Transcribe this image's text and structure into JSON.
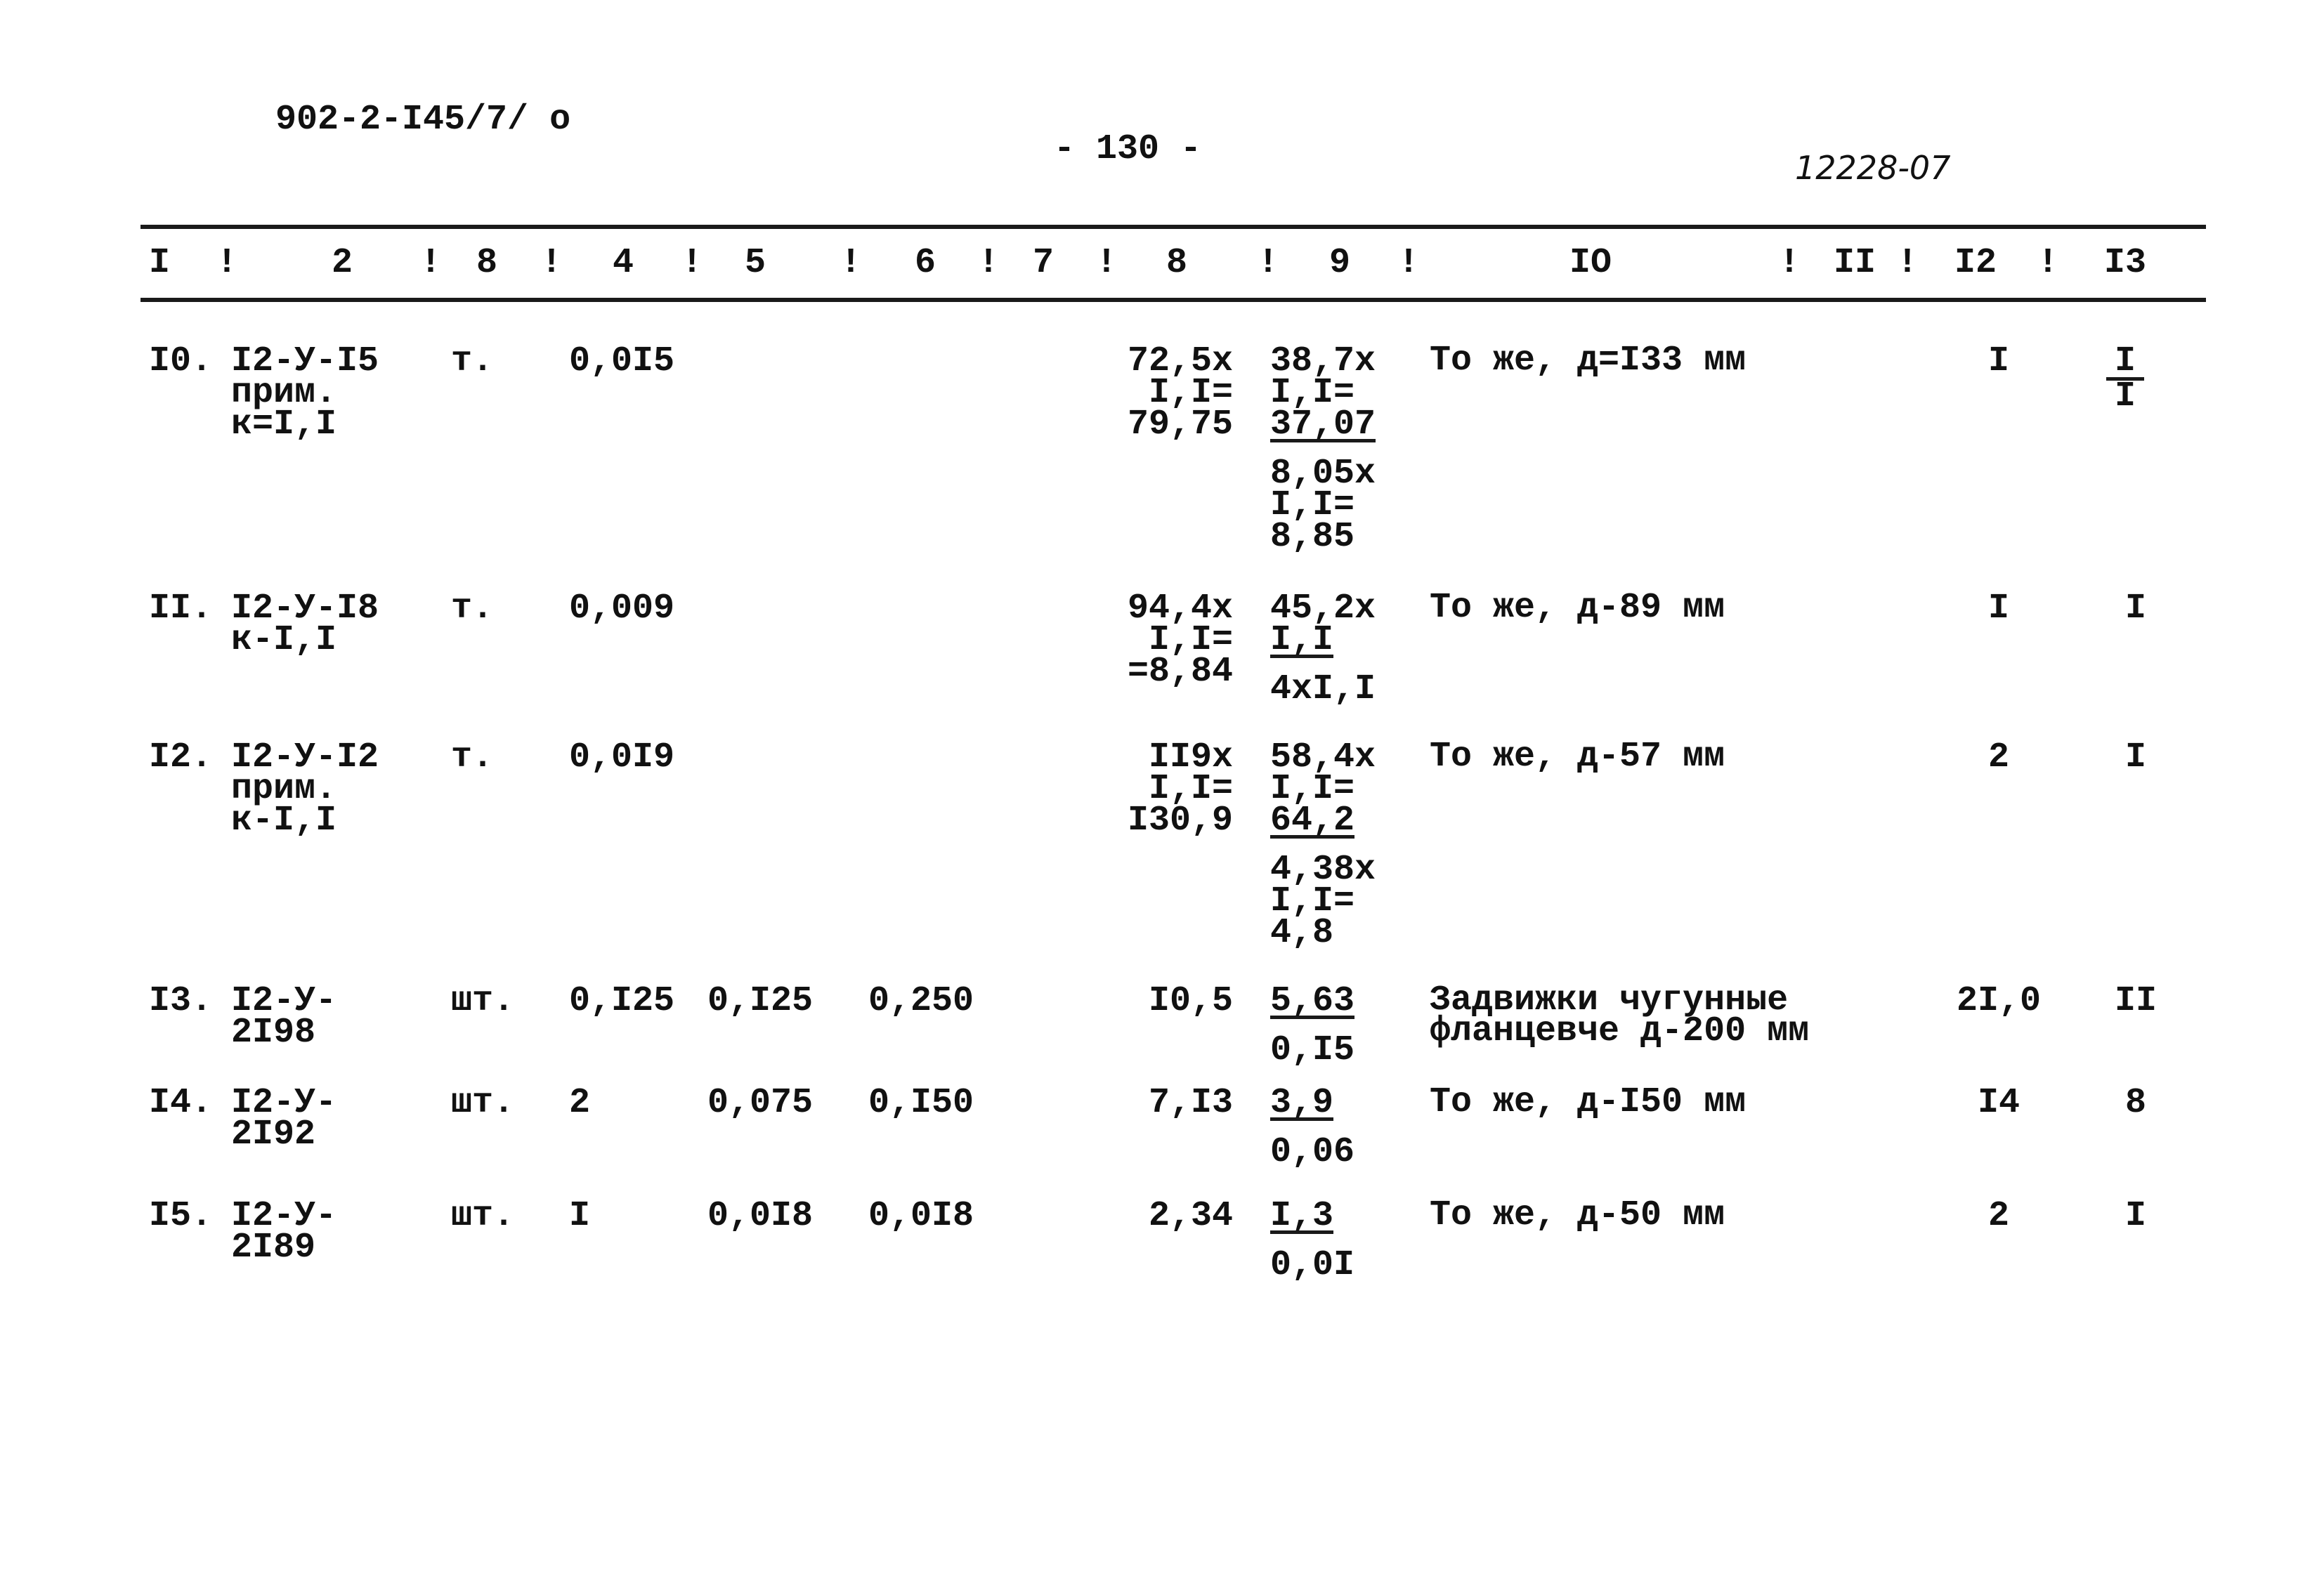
{
  "header": {
    "doc_code": "902-2-I45/7/ о",
    "page_number": "- 130 -",
    "doc_number": "12228-07"
  },
  "table": {
    "columns": [
      "I",
      "!",
      "2",
      "!",
      "8",
      "!",
      "4",
      "!",
      "5",
      "!",
      "6",
      "!",
      "7",
      "!",
      "8",
      "!",
      "9",
      "!",
      "IO",
      "!",
      "II",
      "!",
      "I2",
      "!",
      "I3"
    ],
    "rows": [
      {
        "num": "I0.",
        "code": [
          "I2-У-I5",
          "прим.",
          "к=I,I"
        ],
        "unit": "т.",
        "c4": "0,0I5",
        "c5": "",
        "c6": "",
        "c8": [
          "72,5х",
          "I,I=",
          "79,75"
        ],
        "c9a": [
          "38,7х",
          "I,I="
        ],
        "c9u": "37,07",
        "c9b": [
          "8,05х",
          "I,I=",
          "8,85"
        ],
        "c10": [
          "То же, д=I33 мм"
        ],
        "c12": "I",
        "c13_num": "I",
        "c13_den": "I"
      },
      {
        "num": "II.",
        "code": [
          "I2-У-I8",
          "к-I,I"
        ],
        "unit": "т.",
        "c4": "0,009",
        "c5": "",
        "c6": "",
        "c8": [
          "94,4х",
          "I,I=",
          "=8,84"
        ],
        "c9a": [
          "45,2х"
        ],
        "c9u": "I,I",
        "c9b": [
          "4хI,I"
        ],
        "c10": [
          "То же, д-89 мм"
        ],
        "c12": "I",
        "c13": "I"
      },
      {
        "num": "I2.",
        "code": [
          "I2-У-I2",
          "прим.",
          "к-I,I"
        ],
        "unit": "т.",
        "c4": "0,0I9",
        "c5": "",
        "c6": "",
        "c8": [
          "II9х",
          "I,I=",
          "I30,9"
        ],
        "c9a": [
          "58,4х",
          "I,I="
        ],
        "c9u": "64,2",
        "c9b": [
          "4,38х",
          "I,I=",
          "4,8"
        ],
        "c10": [
          "То же, д-57 мм"
        ],
        "c12": "2",
        "c13": "I"
      },
      {
        "num": "I3.",
        "code": [
          "I2-У-",
          "2I98"
        ],
        "unit": "шт.",
        "c4": "0,I25",
        "c5": "0,I25",
        "c6": "0,250",
        "c8": [
          "I0,5"
        ],
        "c9a": [],
        "c9u": "5,63",
        "c9b": [
          "0,I5"
        ],
        "c10": [
          "Задвижки чугунные",
          "фланцевче д-200 мм"
        ],
        "c12": "2I,0",
        "c13": "II"
      },
      {
        "num": "I4.",
        "code": [
          "I2-У-",
          "2I92"
        ],
        "unit": "шт.",
        "c4": "2",
        "c5": "0,075",
        "c6": "0,I50",
        "c8": [
          "7,I3"
        ],
        "c9a": [],
        "c9u": "3,9",
        "c9b": [
          "0,06"
        ],
        "c10": [
          "То же, д-I50 мм"
        ],
        "c12": "I4",
        "c13": "8"
      },
      {
        "num": "I5.",
        "code": [
          "I2-У-",
          "2I89"
        ],
        "unit": "шт.",
        "c4": "I",
        "c5": "0,0I8",
        "c6": "0,0I8",
        "c8": [
          "2,34"
        ],
        "c9a": [],
        "c9u": "I,3",
        "c9b": [
          "0,0I"
        ],
        "c10": [
          "То же, д-50 мм"
        ],
        "c12": "2",
        "c13": "I"
      }
    ]
  }
}
